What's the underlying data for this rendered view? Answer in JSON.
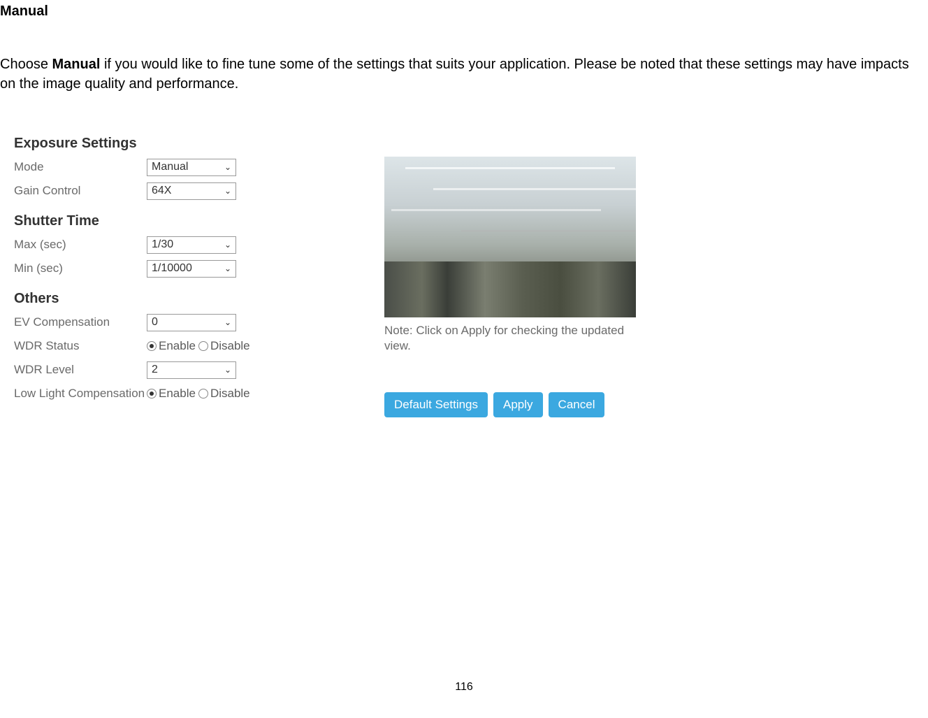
{
  "title": "Manual",
  "intro": {
    "pre": "Choose ",
    "bold": "Manual",
    "post": " if you would like to fine tune some of the settings that suits your application. Please be noted that these settings may have impacts on the image quality and performance."
  },
  "sections": {
    "exposure": {
      "header": "Exposure Settings",
      "mode": {
        "label": "Mode",
        "value": "Manual"
      },
      "gain": {
        "label": "Gain Control",
        "value": "64X"
      }
    },
    "shutter": {
      "header": "Shutter Time",
      "max": {
        "label": "Max (sec)",
        "value": "1/30"
      },
      "min": {
        "label": "Min (sec)",
        "value": "1/10000"
      }
    },
    "others": {
      "header": "Others",
      "ev": {
        "label": "EV Compensation",
        "value": "0"
      },
      "wdr_status": {
        "label": "WDR Status",
        "enable": "Enable",
        "disable": "Disable"
      },
      "wdr_level": {
        "label": "WDR Level",
        "value": "2"
      },
      "low_light": {
        "label": "Low Light Compensation",
        "enable": "Enable",
        "disable": "Disable"
      }
    }
  },
  "note": "Note: Click on Apply for checking the updated view.",
  "buttons": {
    "default": "Default Settings",
    "apply": "Apply",
    "cancel": "Cancel"
  },
  "page_number": "116"
}
